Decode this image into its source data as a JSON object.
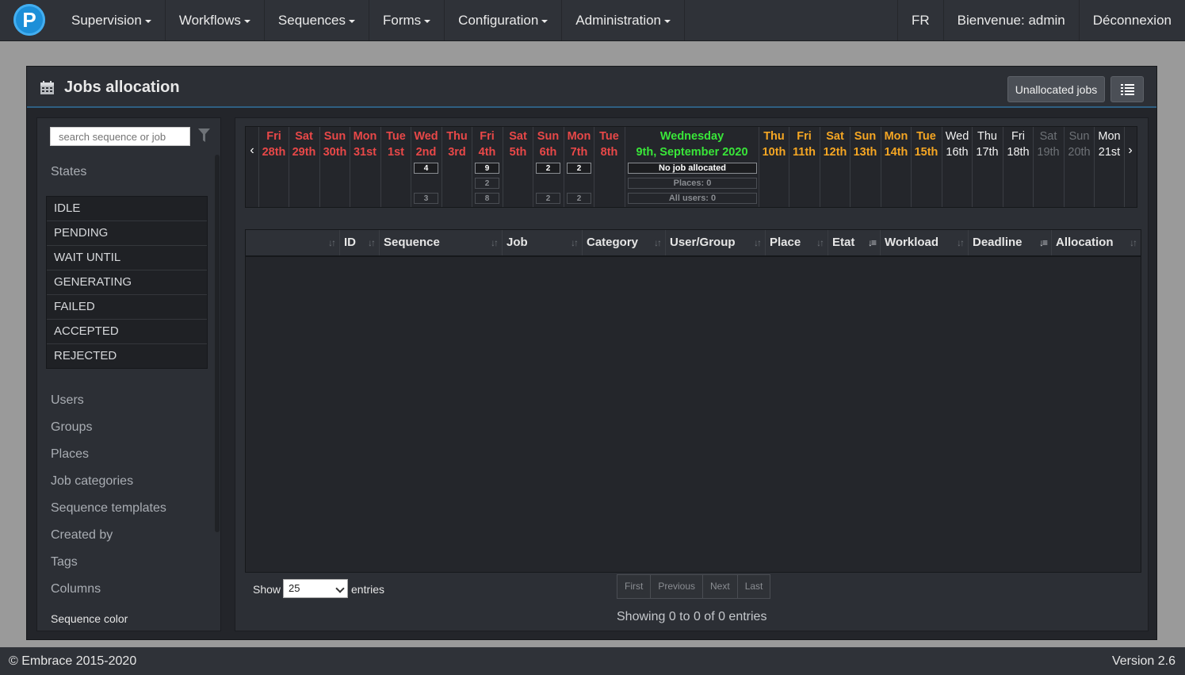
{
  "navbar": {
    "logo_letter": "P",
    "menu": [
      {
        "label": "Supervision"
      },
      {
        "label": "Workflows"
      },
      {
        "label": "Sequences"
      },
      {
        "label": "Forms"
      },
      {
        "label": "Configuration"
      },
      {
        "label": "Administration"
      }
    ],
    "lang": "FR",
    "welcome": "Bienvenue: admin",
    "logout": "Déconnexion"
  },
  "panel": {
    "title": "Jobs allocation",
    "unallocated_button": "Unallocated jobs"
  },
  "sidebar": {
    "search_placeholder": "search sequence or job",
    "states_title": "States",
    "states": [
      "IDLE",
      "PENDING",
      "WAIT UNTIL",
      "GENERATING",
      "FAILED",
      "ACCEPTED",
      "REJECTED"
    ],
    "sections": [
      "Users",
      "Groups",
      "Places",
      "Job categories",
      "Sequence templates",
      "Created by",
      "Tags",
      "Columns"
    ],
    "sequence_color": "Sequence color"
  },
  "timeline": {
    "days_before": [
      {
        "name": "Fri",
        "num": "28th",
        "color": "red"
      },
      {
        "name": "Sat",
        "num": "29th",
        "color": "red"
      },
      {
        "name": "Sun",
        "num": "30th",
        "color": "red"
      },
      {
        "name": "Mon",
        "num": "31st",
        "color": "red"
      },
      {
        "name": "Tue",
        "num": "1st",
        "color": "red"
      },
      {
        "name": "Wed",
        "num": "2nd",
        "color": "red",
        "c1": "4",
        "c3": "3"
      },
      {
        "name": "Thu",
        "num": "3rd",
        "color": "red"
      },
      {
        "name": "Fri",
        "num": "4th",
        "color": "red",
        "c1": "9",
        "c2": "2",
        "c3": "8"
      },
      {
        "name": "Sat",
        "num": "5th",
        "color": "red"
      },
      {
        "name": "Sun",
        "num": "6th",
        "color": "red",
        "c1": "2",
        "c3": "2"
      },
      {
        "name": "Mon",
        "num": "7th",
        "color": "red",
        "c1": "2",
        "c3": "2"
      },
      {
        "name": "Tue",
        "num": "8th",
        "color": "red"
      }
    ],
    "today": {
      "name": "Wednesday",
      "date": "9th, September 2020",
      "status": "No job allocated",
      "places": "Places: 0",
      "users": "All users: 0"
    },
    "days_after": [
      {
        "name": "Thu",
        "num": "10th",
        "color": "orange"
      },
      {
        "name": "Fri",
        "num": "11th",
        "color": "orange"
      },
      {
        "name": "Sat",
        "num": "12th",
        "color": "orange"
      },
      {
        "name": "Sun",
        "num": "13th",
        "color": "orange"
      },
      {
        "name": "Mon",
        "num": "14th",
        "color": "orange"
      },
      {
        "name": "Tue",
        "num": "15th",
        "color": "orange"
      },
      {
        "name": "Wed",
        "num": "16th",
        "color": "white"
      },
      {
        "name": "Thu",
        "num": "17th",
        "color": "white"
      },
      {
        "name": "Fri",
        "num": "18th",
        "color": "white"
      },
      {
        "name": "Sat",
        "num": "19th",
        "color": "grey"
      },
      {
        "name": "Sun",
        "num": "20th",
        "color": "grey"
      },
      {
        "name": "Mon",
        "num": "21st",
        "color": "white"
      }
    ]
  },
  "table": {
    "columns": [
      {
        "label": ""
      },
      {
        "label": "ID"
      },
      {
        "label": "Sequence"
      },
      {
        "label": "Job"
      },
      {
        "label": "Category"
      },
      {
        "label": "User/Group"
      },
      {
        "label": "Place"
      },
      {
        "label": "Etat"
      },
      {
        "label": "Workload"
      },
      {
        "label": "Deadline"
      },
      {
        "label": "Allocation"
      }
    ],
    "rows": []
  },
  "controls": {
    "show_label": "Show",
    "page_size": "25",
    "entries_label": "entries",
    "pager": [
      "First",
      "Previous",
      "Next",
      "Last"
    ],
    "info": "Showing 0 to 0 of 0 entries"
  },
  "footer": {
    "copyright": "© Embrace 2015-2020",
    "version": "Version 2.6"
  },
  "colors": {
    "past": "#e84848",
    "upcoming": "#f5a623",
    "today": "#39e639",
    "accent": "#2f5f82"
  }
}
